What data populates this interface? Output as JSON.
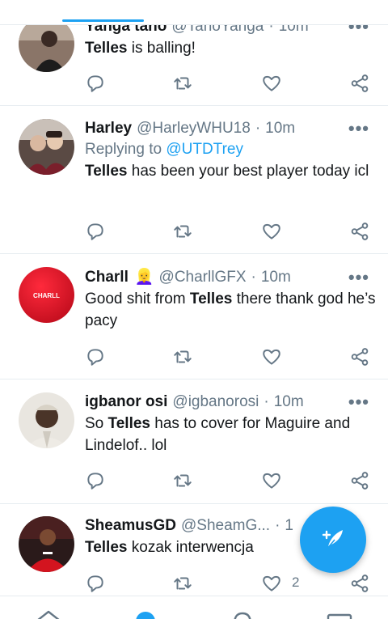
{
  "colors": {
    "accent": "#1da1f2",
    "secondary_text": "#657786",
    "divider": "#e6ecf0"
  },
  "tweets": [
    {
      "name": "Yanga tano",
      "handle": "@TanoYanga",
      "sep": "·",
      "time": "10m",
      "reply_prefix": "",
      "reply_mention": "",
      "bold": "Telles",
      "text_rest": " is balling!",
      "like_count": ""
    },
    {
      "name": "Harley",
      "handle": "@HarleyWHU18",
      "sep": "·",
      "time": "10m",
      "reply_prefix": "Replying to ",
      "reply_mention": "@UTDTrey",
      "bold": "Telles",
      "text_rest": " has been your best player today icl",
      "like_count": ""
    },
    {
      "name": "Charll",
      "emoji": "👱‍♀️",
      "handle": "@CharllGFX",
      "sep": "·",
      "time": "10m",
      "reply_prefix": "",
      "reply_mention": "",
      "pre": "Good shit from ",
      "bold": "Telles",
      "text_rest": " there thank god he’s pacy",
      "like_count": "",
      "avatar_label": "CHARLL"
    },
    {
      "name": "igbanor osi",
      "handle": "@igbanorosi",
      "sep": "·",
      "time": "10m",
      "reply_prefix": "",
      "reply_mention": "",
      "pre": "So ",
      "bold": "Telles",
      "text_rest": " has to cover for Maguire and Lindelof.. lol",
      "like_count": ""
    },
    {
      "name": "SheamusGD",
      "handle": "@SheamG...",
      "sep": "·",
      "time": "1",
      "reply_prefix": "",
      "reply_mention": "",
      "bold": "Telles",
      "text_rest": " kozak interwencja",
      "like_count": "2"
    }
  ],
  "icons": {
    "reply": "reply-icon",
    "retweet": "retweet-icon",
    "like": "heart-icon",
    "share": "share-icon",
    "more": "more-dots-icon",
    "compose": "compose-feather-icon",
    "nav": [
      "home-icon",
      "search-icon",
      "notifications-icon",
      "messages-icon"
    ]
  },
  "more_glyph": "•••"
}
